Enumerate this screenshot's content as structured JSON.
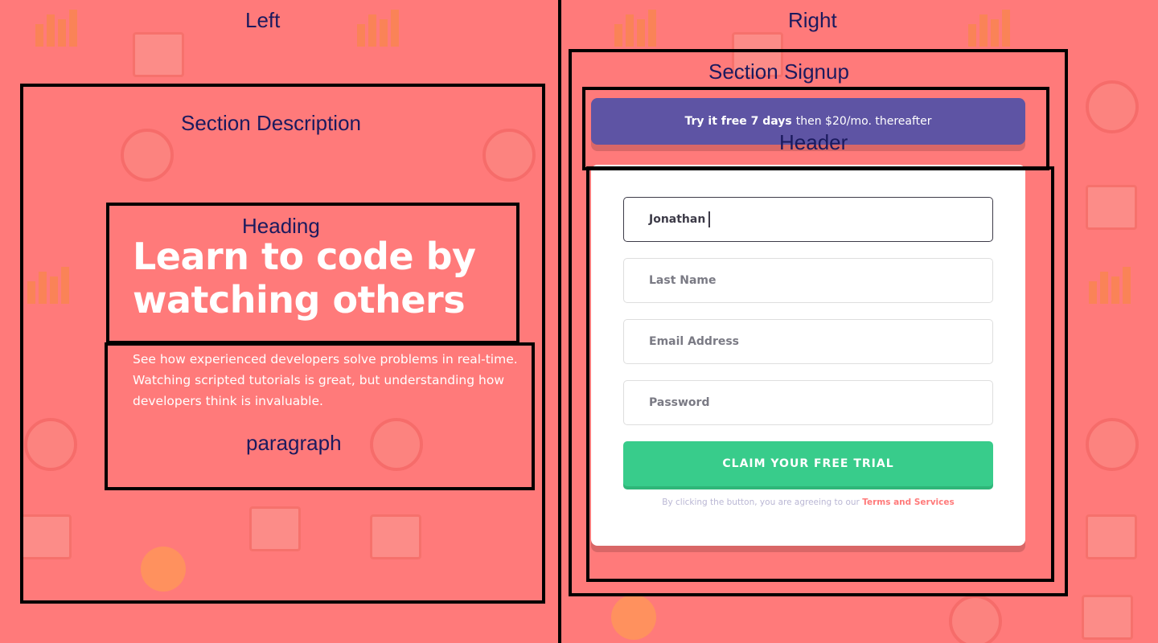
{
  "annotations": {
    "left": "Left",
    "right": "Right",
    "section_description": "Section Description",
    "heading": "Heading",
    "paragraph": "paragraph",
    "section_signup": "Section Signup",
    "header": "Header"
  },
  "description": {
    "heading": "Learn to code by watching others",
    "paragraph": "See how experienced developers solve problems in real-time. Watching scripted tutorials is great, but understanding how developers think is invaluable."
  },
  "promo": {
    "bold": "Try it free 7 days",
    "rest": "then $20/mo. thereafter"
  },
  "form": {
    "first_name_value": "Jonathan",
    "last_name_placeholder": "Last Name",
    "email_placeholder": "Email Address",
    "password_placeholder": "Password",
    "submit_label": "CLAIM YOUR FREE TRIAL",
    "terms_text": "By clicking the button, you are agreeing to our",
    "terms_link": "Terms and Services"
  },
  "colors": {
    "background": "#ff7a7a",
    "promo": "#5e54a4",
    "cta": "#38cc8b",
    "annotation_text": "#1b1a5e"
  }
}
